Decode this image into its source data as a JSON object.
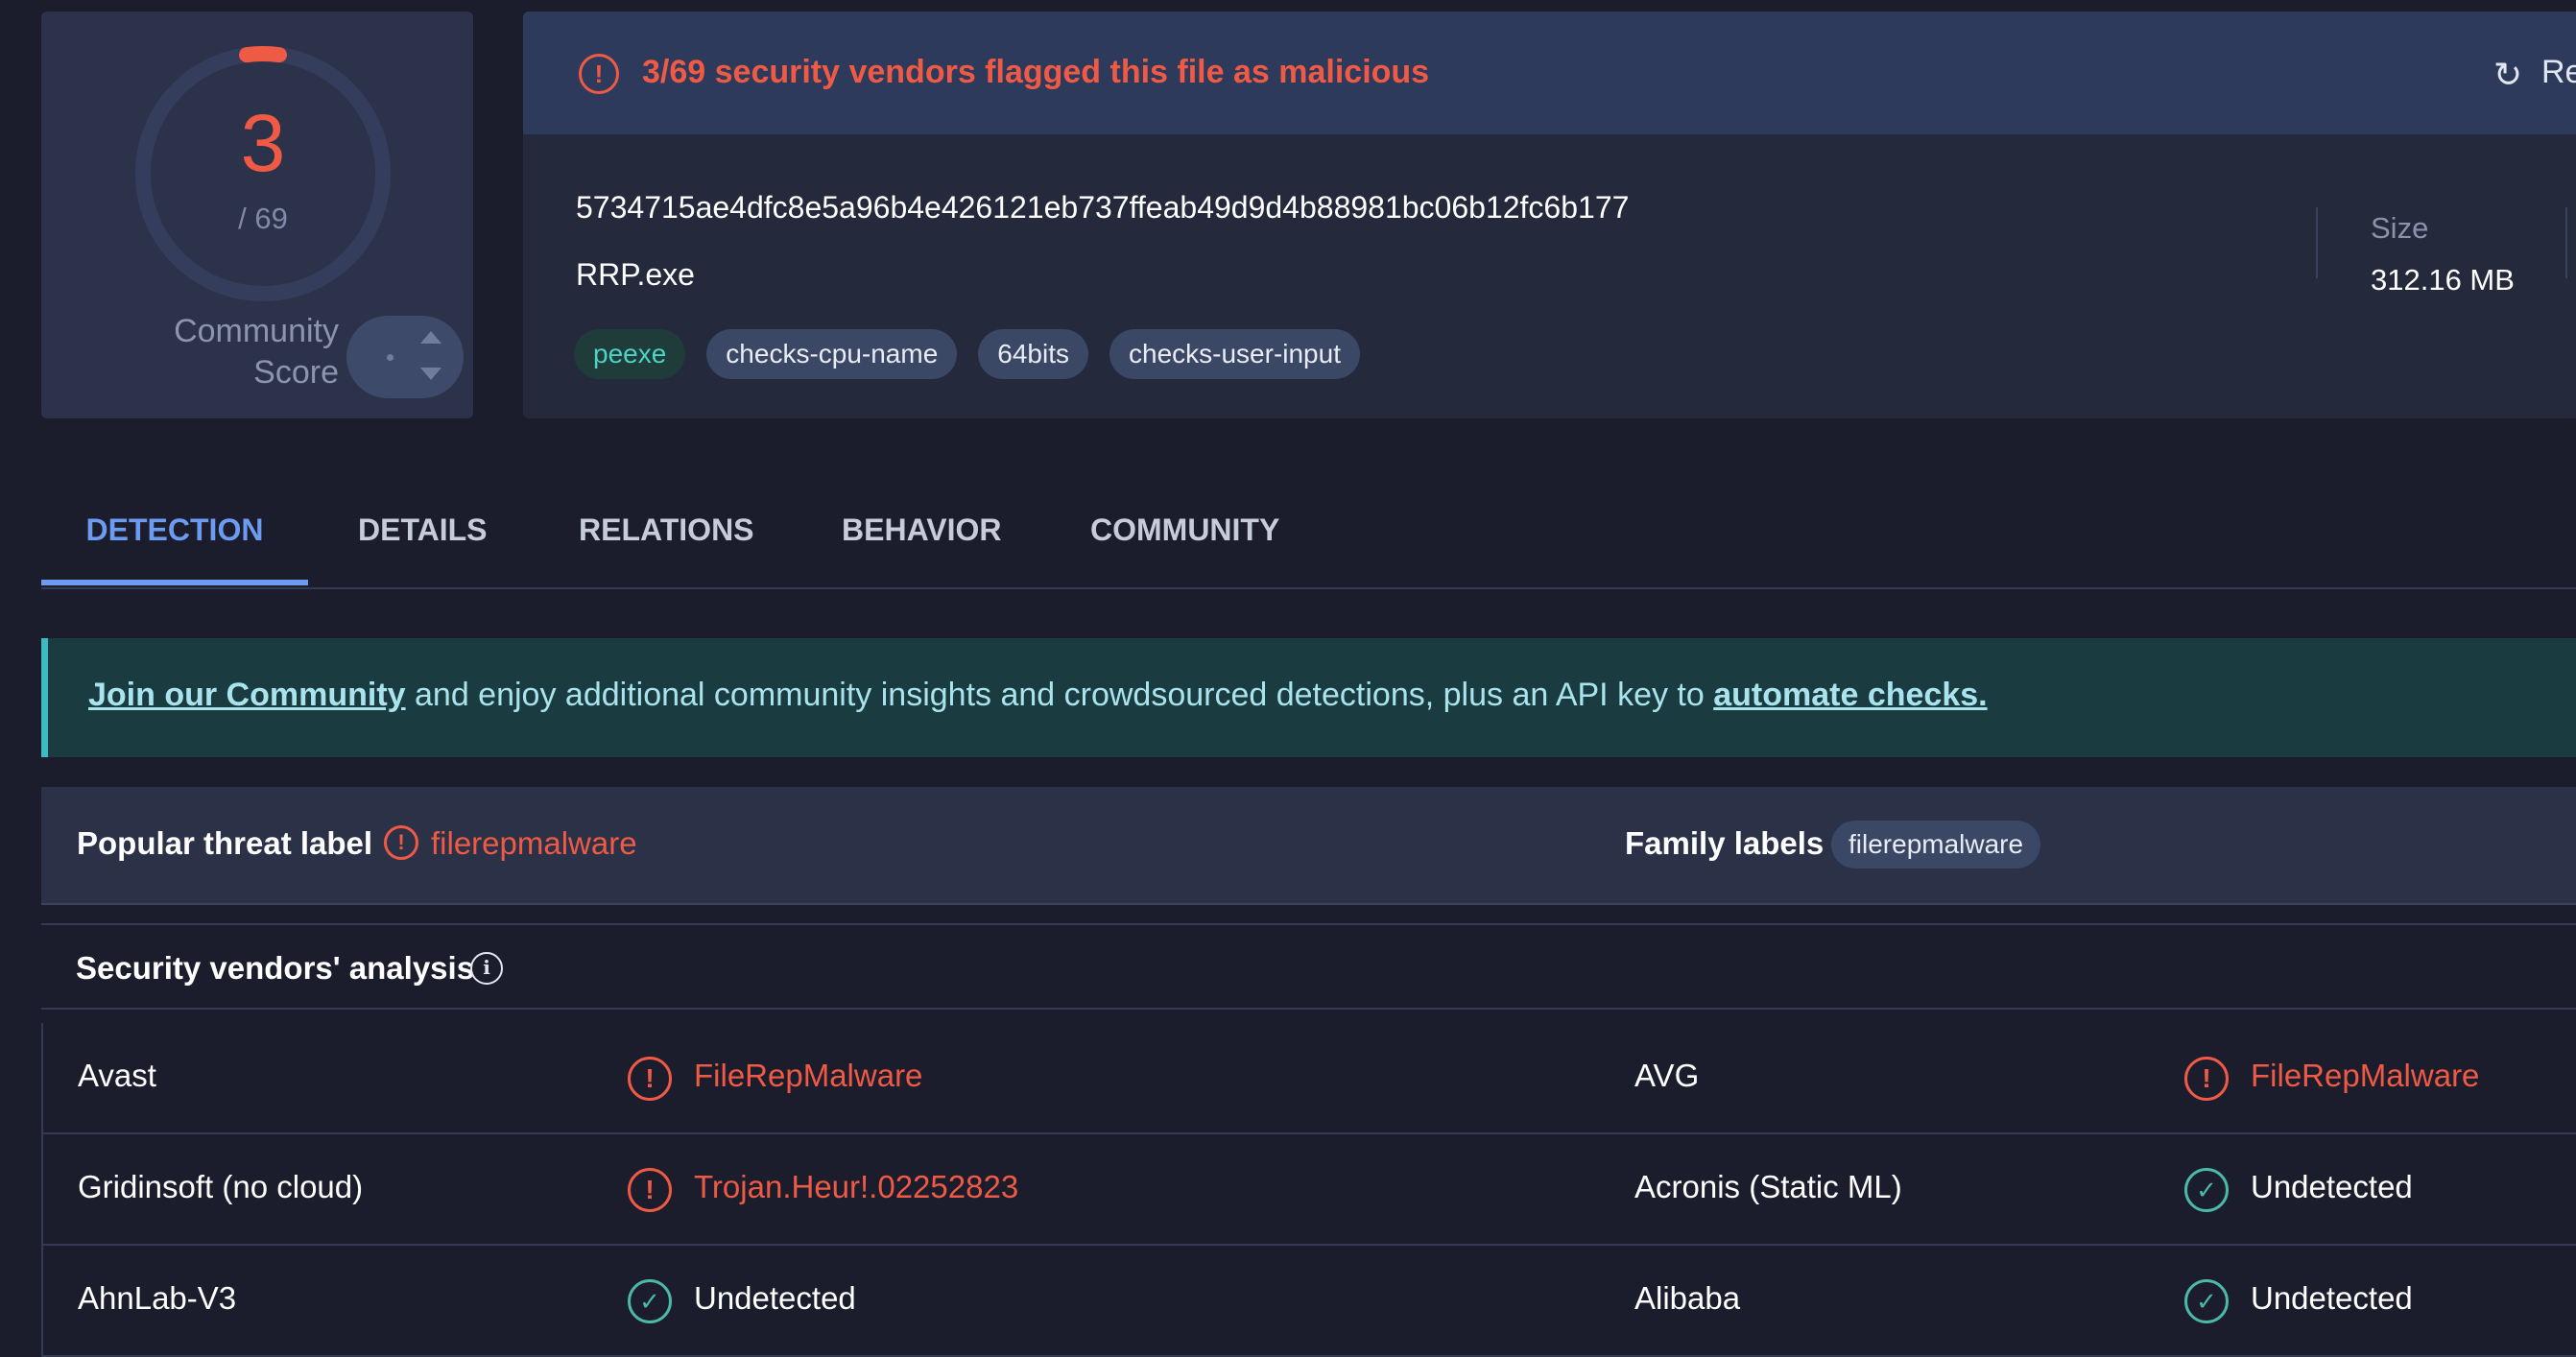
{
  "score": {
    "detections": "3",
    "total": "/ 69",
    "community_label": "Community Score"
  },
  "alert": {
    "text": "3/69 security vendors flagged this file as malicious",
    "reanalyze_label": "Re"
  },
  "file": {
    "hash": "5734715ae4dfc8e5a96b4e426121eb737ffeab49d9d4b88981bc06b12fc6b177",
    "name": "RRP.exe",
    "tags": [
      "peexe",
      "checks-cpu-name",
      "64bits",
      "checks-user-input"
    ],
    "size_label": "Size",
    "size_value": "312.16 MB"
  },
  "tabs": [
    "DETECTION",
    "DETAILS",
    "RELATIONS",
    "BEHAVIOR",
    "COMMUNITY"
  ],
  "banner": {
    "link1": "Join our Community",
    "middle": " and enjoy additional community insights and crowdsourced detections, plus an API key to ",
    "link2": "automate checks."
  },
  "threat": {
    "title": "Popular threat label",
    "value": "filerepmalware",
    "family_title": "Family labels",
    "family_value": "filerepmalware"
  },
  "vendors": {
    "title": "Security vendors' analysis",
    "info_glyph": "i",
    "rows": [
      {
        "left": {
          "name": "Avast",
          "result": "FileRepMalware",
          "status": "malicious"
        },
        "right": {
          "name": "AVG",
          "result": "FileRepMalware",
          "status": "malicious"
        }
      },
      {
        "left": {
          "name": "Gridinsoft (no cloud)",
          "result": "Trojan.Heur!.02252823",
          "status": "malicious"
        },
        "right": {
          "name": "Acronis (Static ML)",
          "result": "Undetected",
          "status": "clean"
        }
      },
      {
        "left": {
          "name": "AhnLab-V3",
          "result": "Undetected",
          "status": "clean"
        },
        "right": {
          "name": "Alibaba",
          "result": "Undetected",
          "status": "clean"
        }
      }
    ]
  },
  "colors": {
    "malicious": "#ef5a45",
    "clean": "#4bb8a8",
    "accent": "#6d9bf0",
    "background": "#1b1c2c"
  }
}
